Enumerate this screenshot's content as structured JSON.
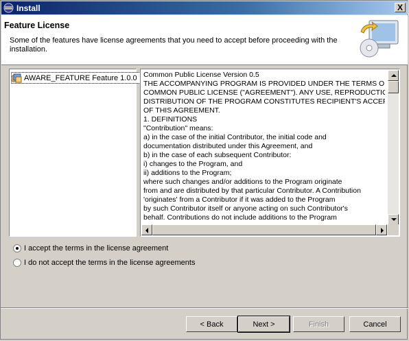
{
  "window": {
    "title": "Install",
    "close_symbol": "X"
  },
  "banner": {
    "title": "Feature License",
    "description": "Some of the features have license agreements that you need to accept before proceeding with the installation."
  },
  "features": [
    {
      "label": "AWARE_FEATURE Feature 1.0.0",
      "icon": "feature-icon"
    }
  ],
  "license": {
    "text": "Common Public License Version 0.5\nTHE ACCOMPANYING PROGRAM IS PROVIDED UNDER THE TERMS OF TH\nCOMMON PUBLIC LICENSE (\"AGREEMENT\"). ANY USE, REPRODUCTION C\nDISTRIBUTION OF THE PROGRAM CONSTITUTES RECIPIENT'S ACCEPTAI\nOF THIS AGREEMENT.\n1. DEFINITIONS\n\"Contribution\" means:\na) in the case of the initial Contributor, the initial code and\ndocumentation distributed under this Agreement, and\nb) in the case of each subsequent Contributor:\ni) changes to the Program, and\nii) additions to the Program;\nwhere such changes and/or additions to the Program originate\nfrom and are distributed by that particular Contributor. A Contribution\n'originates' from a Contributor if it was added to the Program\nby such Contributor itself or anyone acting on such Contributor's\nbehalf. Contributions do not include additions to the Program"
  },
  "options": {
    "accept": "I accept the terms in the license agreement",
    "decline": "I do not accept the terms in the license agreements",
    "selected": "accept"
  },
  "buttons": {
    "back": "< Back",
    "next": "Next >",
    "finish": "Finish",
    "cancel": "Cancel"
  }
}
